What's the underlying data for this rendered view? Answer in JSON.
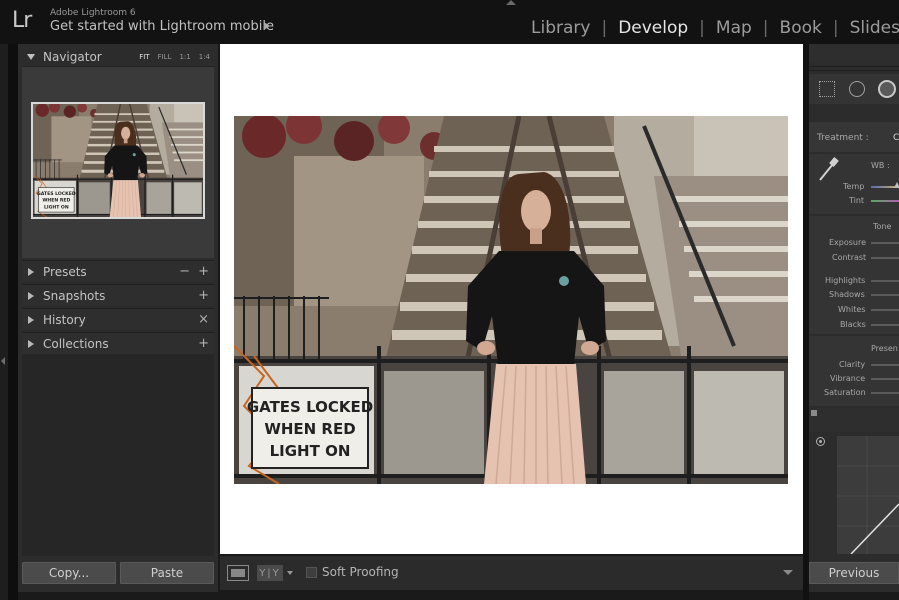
{
  "titlebar": {
    "logo": "Lr",
    "app_name": "Adobe Lightroom 6",
    "identity_plate": "Get started with Lightroom mobile"
  },
  "modules": [
    "Library",
    "Develop",
    "Map",
    "Book",
    "Slideshow"
  ],
  "active_module": "Develop",
  "left_panel": {
    "navigator": {
      "title": "Navigator",
      "zoom": [
        "FIT",
        "FILL",
        "1:1",
        "1:4"
      ]
    },
    "panels": [
      {
        "label": "Presets",
        "actions": [
          "−",
          "+"
        ]
      },
      {
        "label": "Snapshots",
        "actions": [
          "+"
        ]
      },
      {
        "label": "History",
        "actions": [
          "×"
        ]
      },
      {
        "label": "Collections",
        "actions": [
          "+"
        ]
      }
    ],
    "copy_button": "Copy...",
    "paste_button": "Paste"
  },
  "photo": {
    "sign_text": [
      "GATES LOCKED",
      "WHEN RED",
      "LIGHT ON"
    ]
  },
  "toolbar": {
    "view_modes": "Y|Y",
    "soft_proofing_label": "Soft Proofing"
  },
  "right_panel": {
    "treatment_label": "Treatment :",
    "treatment_value": "C",
    "wb_label": "WB :",
    "basic": {
      "temp": "Temp",
      "tint": "Tint",
      "tone": "Tone",
      "exposure": "Exposure",
      "contrast": "Contrast",
      "highlights": "Highlights",
      "shadows": "Shadows",
      "whites": "Whites",
      "blacks": "Blacks",
      "presence": "Presen",
      "clarity": "Clarity",
      "vibrance": "Vibrance",
      "saturation": "Saturation"
    },
    "previous_button": "Previous"
  }
}
